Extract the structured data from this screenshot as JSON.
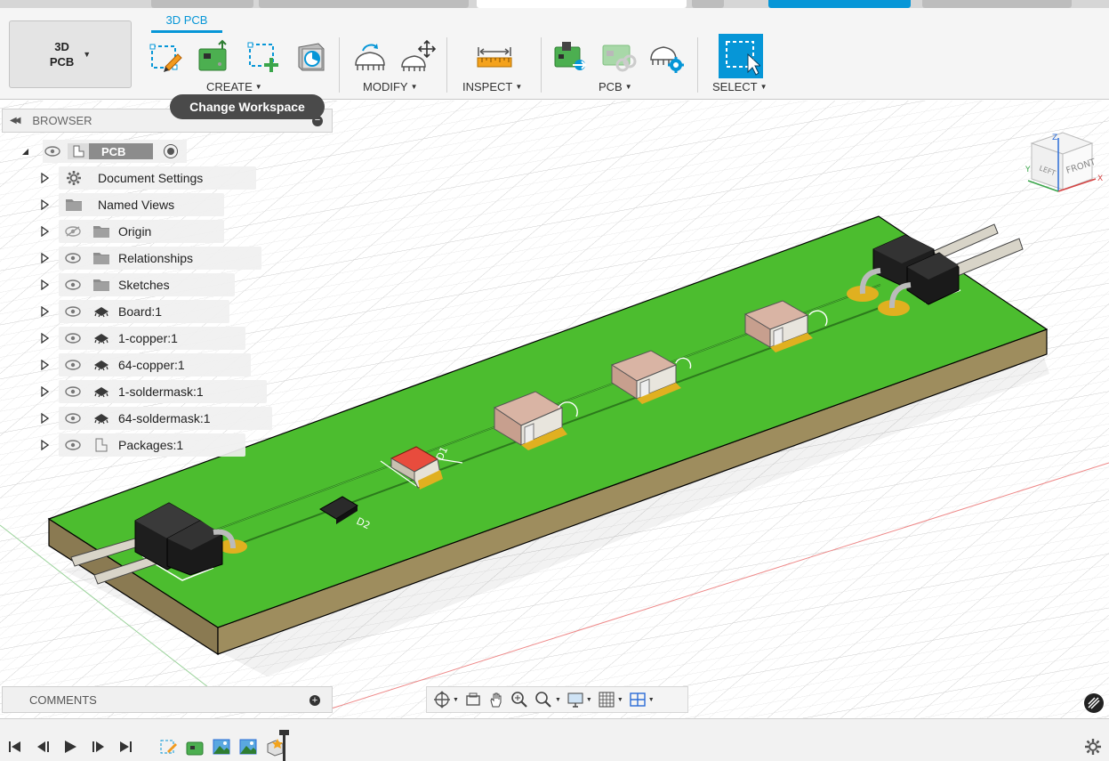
{
  "workspace": {
    "line1": "3D",
    "line2": "PCB"
  },
  "toolbar": {
    "active_tab": "3D PCB",
    "groups": {
      "create": "CREATE",
      "modify": "MODIFY",
      "inspect": "INSPECT",
      "pcb": "PCB",
      "select": "SELECT"
    }
  },
  "tooltip": "Change Workspace",
  "browser": {
    "title": "BROWSER",
    "root": "PCB",
    "items": [
      {
        "label": "Document Settings",
        "icon": "gear-icon"
      },
      {
        "label": "Named Views",
        "icon": "folder-icon"
      },
      {
        "label": "Origin",
        "icon": "folder-icon",
        "hidden": true
      },
      {
        "label": "Relationships",
        "icon": "folder-icon"
      },
      {
        "label": "Sketches",
        "icon": "folder-icon"
      },
      {
        "label": "Board:1",
        "icon": "chip-icon"
      },
      {
        "label": "1-copper:1",
        "icon": "chip-icon"
      },
      {
        "label": "64-copper:1",
        "icon": "chip-icon"
      },
      {
        "label": "1-soldermask:1",
        "icon": "chip-icon"
      },
      {
        "label": "64-soldermask:1",
        "icon": "chip-icon"
      },
      {
        "label": "Packages:1",
        "icon": "component-icon"
      }
    ]
  },
  "comments": {
    "title": "COMMENTS"
  },
  "viewcube": {
    "front": "FRONT",
    "left": "LEFT",
    "top_axis": "Z",
    "x_axis": "X",
    "y_axis": "Y"
  },
  "scene": {
    "board_color": "#4cbd2f",
    "board_edge_color": "#8a7a52",
    "labels": {
      "d2": "D2",
      "d1": "D1"
    }
  },
  "colors": {
    "accent": "#0696d7",
    "tooltip_bg": "#4a4a4a"
  }
}
